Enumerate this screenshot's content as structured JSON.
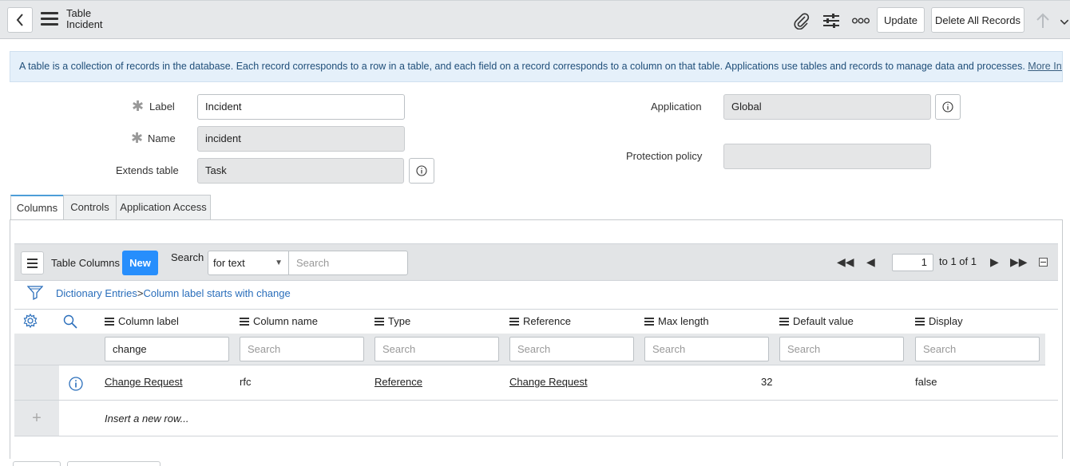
{
  "header": {
    "line1": "Table",
    "line2": "Incident",
    "update_label": "Update",
    "delete_all_label": "Delete All Records"
  },
  "info": {
    "text": "A table is a collection of records in the database. Each record corresponds to a row in a table, and each field on a record corresponds to a column on that table. Applications use tables and records to manage data and processes.",
    "link": "More Info"
  },
  "form": {
    "label_label": "Label",
    "label_value": "Incident",
    "name_label": "Name",
    "name_value": "incident",
    "extends_label": "Extends table",
    "extends_value": "Task",
    "application_label": "Application",
    "application_value": "Global",
    "protection_label": "Protection policy",
    "protection_value": ""
  },
  "tabs": [
    {
      "label": "Columns"
    },
    {
      "label": "Controls"
    },
    {
      "label": "Application Access"
    }
  ],
  "list": {
    "title": "Table Columns",
    "new_label": "New",
    "search_label": "Search",
    "search_mode": "for text",
    "search_placeholder": "Search",
    "page_value": "1",
    "page_of": "to 1 of 1",
    "breadcrumb_root": "Dictionary Entries",
    "breadcrumb_sep": ">",
    "breadcrumb_filter": "Column label starts with change",
    "columns": [
      "Column label",
      "Column name",
      "Type",
      "Reference",
      "Max length",
      "Default value",
      "Display"
    ],
    "filter_values": [
      "change",
      "",
      "",
      "",
      "",
      "",
      ""
    ],
    "filter_placeholder": "Search",
    "rows": [
      {
        "column_label": "Change Request",
        "column_name": "rfc",
        "type": "Reference",
        "reference": "Change Request",
        "max_length": "32",
        "default_value": "",
        "display": "false"
      }
    ],
    "insert_label": "Insert a new row..."
  }
}
